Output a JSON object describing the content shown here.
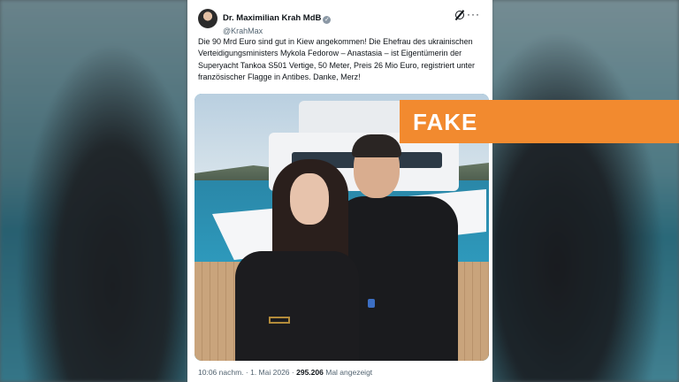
{
  "tweet": {
    "author_name": "Dr. Maximilian Krah MdB",
    "handle": "@KrahMax",
    "text": "Die 90 Mrd Euro sind gut in Kiew angekommen! Die Ehefrau des ukrainischen Verteidigungsministers Mykola Fedorow – Anastasia – ist Eigentümerin der Superyacht Tankoa S501 Vertige, 50 Meter, Preis 26 Mio Euro, registriert unter französischer Flagge in Antibes. Danke, Merz!",
    "time": "10:06 nachm.",
    "separator1": "·",
    "date": "1. Mai 2026",
    "separator2": "·",
    "views": "295.206",
    "views_label": "Mal angezeigt",
    "verified_glyph": "✓",
    "more_glyph": "···"
  },
  "overlay": {
    "label": "FAKE",
    "color": "#f28a2f"
  },
  "icons": [
    "avatar",
    "verified-badge-icon",
    "grok-icon",
    "more-icon"
  ]
}
